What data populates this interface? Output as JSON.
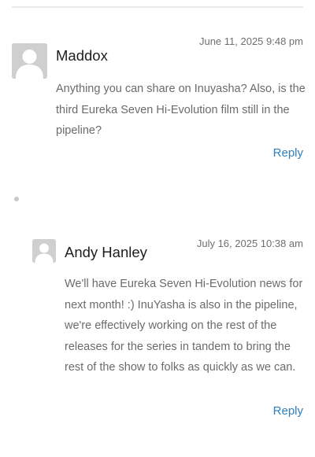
{
  "comments": [
    {
      "author": "Maddox",
      "date": "June 11, 2025 9:48 pm",
      "text": "Anything you can share on Inuyasha? Also, is the third Eureka Seven Hi-Evolution film still in the pipeline?",
      "reply_label": "Reply"
    },
    {
      "author": "Andy Hanley",
      "date": "July 16, 2025 10:38 am",
      "text": "We'll have Eureka Seven Hi-Evolution news for next month! :) InuYasha is also in the pipeline, we're effectively working on the rest of the releases for the series in tandem to bring the rest of the show to folks as quickly as we can.",
      "reply_label": "Reply"
    }
  ],
  "icons": {
    "avatar": "default-user-avatar-icon",
    "bullet": "list-bullet-icon"
  },
  "colors": {
    "link": "#2f7fbd",
    "text_muted": "#6b6b6b",
    "avatar_bg": "#cfcfcf"
  }
}
